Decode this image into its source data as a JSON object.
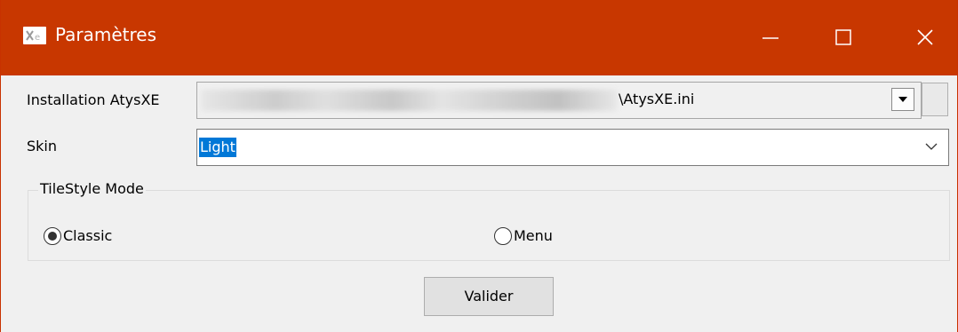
{
  "window": {
    "title": "Paramètres",
    "accent_color": "#c83700",
    "controls": {
      "minimize_icon": "minimize-icon",
      "maximize_icon": "maximize-icon",
      "close_icon": "close-icon"
    }
  },
  "form": {
    "installation": {
      "label": "Installation AtysXE",
      "value_visible": "\\AtysXE.ini",
      "dropdown_icon": "dropdown-arrow-icon"
    },
    "skin": {
      "label": "Skin",
      "value": "Light",
      "selection_color": "#0078d7"
    },
    "tilestyle": {
      "legend": "TileStyle Mode",
      "options": [
        {
          "label": "Classic",
          "selected": true
        },
        {
          "label": "Menu",
          "selected": false
        }
      ]
    },
    "submit_label": "Valider"
  }
}
